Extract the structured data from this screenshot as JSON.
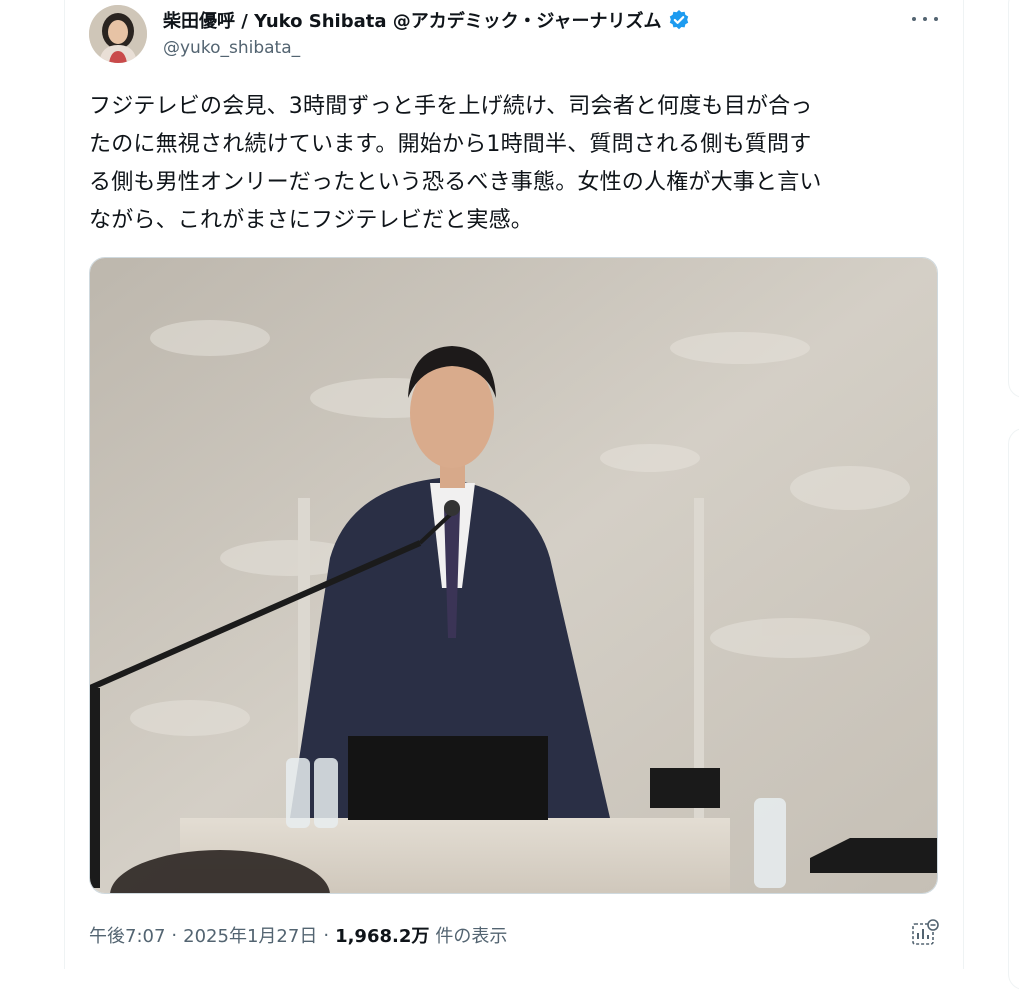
{
  "tweet": {
    "author": {
      "display_name": "柴田優呼 / Yuko Shibata @アカデミック・ジャーナリズム",
      "handle": "@yuko_shibata_",
      "verified": true
    },
    "text_lines": [
      "フジテレビの会見、3時間ずっと手を上げ続け、司会者と何度も目が合っ",
      "たのに無視され続けています。開始から1時間半、質問される側も質問す",
      "る側も男性オンリーだったという恐るべき事態。女性の人権が大事と言い",
      "ながら、これがまさにフジテレビだと実感。"
    ],
    "meta": {
      "time": "午後7:07",
      "separator": "·",
      "date": "2025年1月27日",
      "views_count": "1,968.2万",
      "views_label": "件の表示"
    }
  },
  "icons": {
    "verified": "verified-badge-icon",
    "more": "more-options-icon",
    "analytics": "analytics-icon"
  },
  "colors": {
    "text_primary": "#0f1419",
    "text_secondary": "#536471",
    "verified_blue": "#1d9bf0",
    "border": "#cfd9de"
  }
}
